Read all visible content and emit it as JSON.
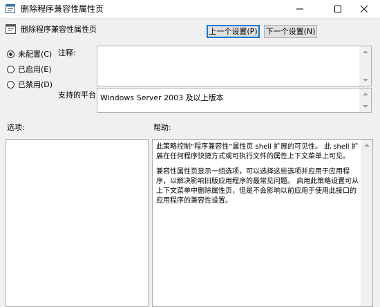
{
  "window": {
    "title": "删除程序兼容性属性页",
    "controls": {
      "minimize": "minimize-icon",
      "maximize": "maximize-icon",
      "close": "close-icon"
    }
  },
  "header": {
    "policy_title": "删除程序兼容性属性页",
    "prev_button": "上一个设置(P)",
    "next_button": "下一个设置(N)"
  },
  "state": {
    "options": [
      {
        "label": "未配置(C)",
        "checked": true
      },
      {
        "label": "已启用(E)",
        "checked": false
      },
      {
        "label": "已禁用(D)",
        "checked": false
      }
    ]
  },
  "comment": {
    "label": "注释:",
    "value": ""
  },
  "platform": {
    "label": "支持的平台:",
    "value": "Windows Server 2003 及以上版本"
  },
  "options_section": {
    "label": "选项:"
  },
  "help_section": {
    "label": "帮助:",
    "paragraphs": [
      "此策略控制“程序兼容性”属性页 shell 扩展的可见性。 此 shell 扩展在任何程序快捷方式或可执行文件的属性上下文菜单上可见。",
      "兼容性属性页显示一组选项，可以选择这些选项并应用于应用程序，以解决影响旧版应用程序的最常见问题。 启用此策略设置可从上下文菜单中删除属性页，但是不会影响以前应用于使用此接口的应用程序的兼容性设置。"
    ]
  },
  "colors": {
    "background": "#f0f0f0",
    "accent": "#0078d7",
    "border": "#adadad"
  }
}
